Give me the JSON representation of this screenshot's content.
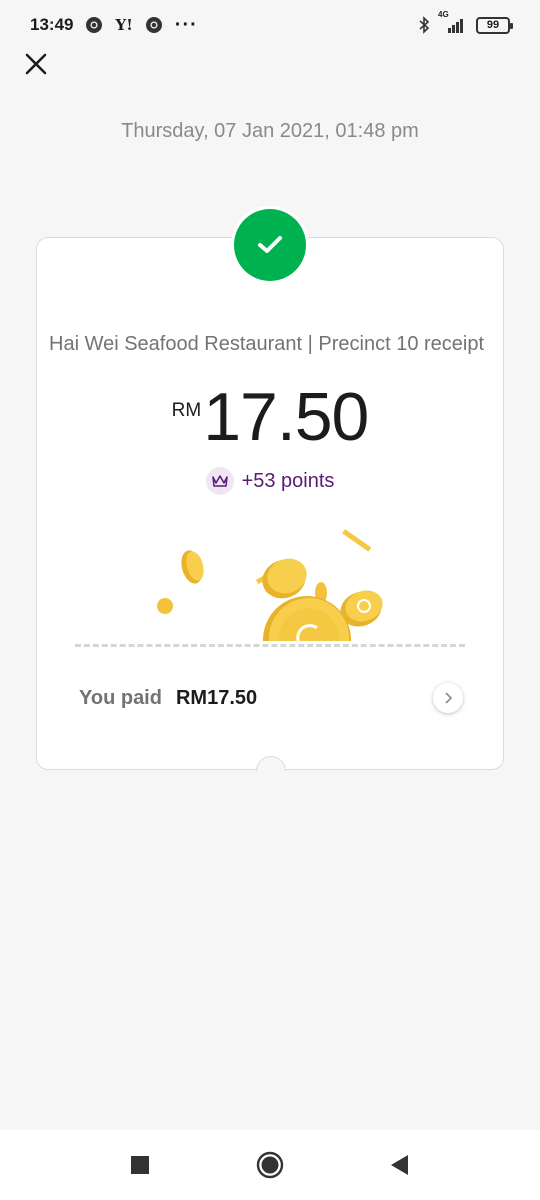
{
  "status_bar": {
    "time": "13:49",
    "left_icons": [
      "chrome-icon",
      "yahoo-icon",
      "chrome-icon",
      "more-dots-icon"
    ],
    "yahoo_text": "Y!",
    "dots": "···",
    "network": "4G",
    "battery": "99"
  },
  "header": {
    "close_icon": "close-icon",
    "date": "Thursday, 07 Jan 2021, 01:48 pm"
  },
  "receipt": {
    "status_icon": "check-icon",
    "status_color": "#00b14f",
    "merchant": "Hai Wei Seafood Restaurant | Precinct 10 receipt",
    "currency": "RM",
    "amount": "17.50",
    "points_icon": "crown-icon",
    "points": "+53 points",
    "paid_label": "You paid",
    "paid_value": "RM17.50",
    "chevron_icon": "chevron-right-icon"
  },
  "nav_bar": {
    "items": [
      "recents-square-icon",
      "home-circle-icon",
      "back-triangle-icon"
    ]
  }
}
